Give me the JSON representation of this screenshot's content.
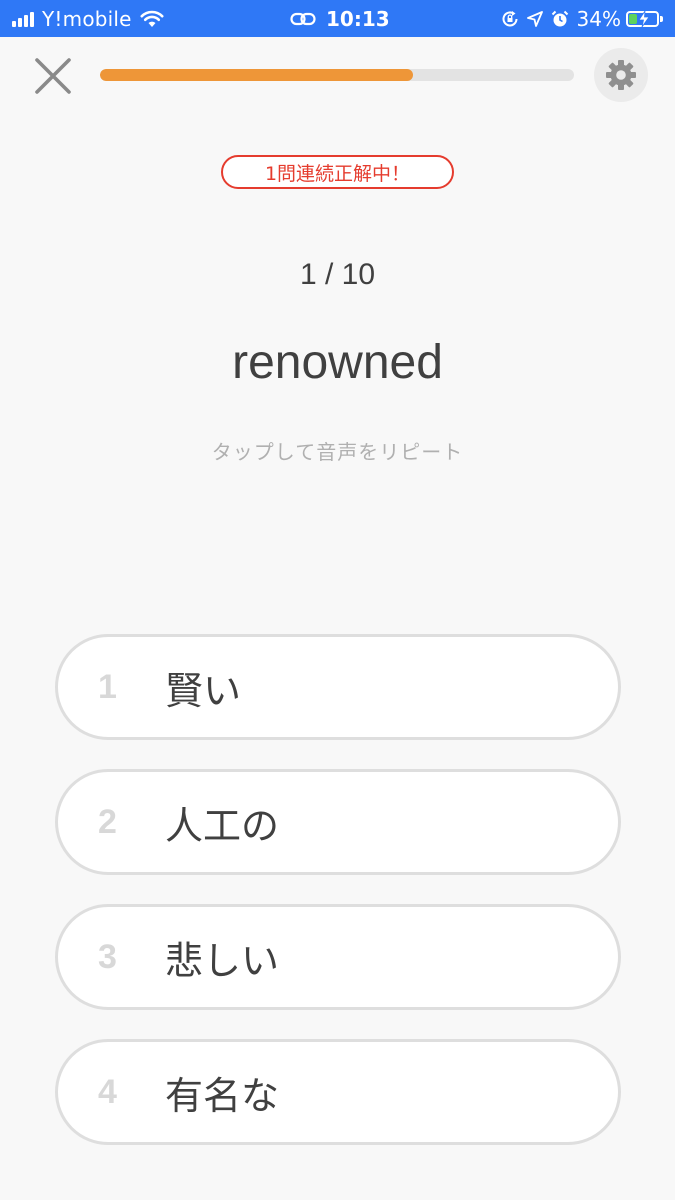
{
  "status_bar": {
    "carrier": "Y!mobile",
    "time": "10:13",
    "battery_percent": "34%",
    "battery_level": 0.34,
    "icons": [
      "signal-icon",
      "wifi-icon",
      "link-icon",
      "orientation-lock-icon",
      "location-icon",
      "alarm-icon",
      "battery-icon",
      "charging-icon"
    ]
  },
  "quiz": {
    "progress_fraction": 0.66,
    "streak_text": "1問連続正解中！",
    "counter": "1 / 10",
    "word": "renowned",
    "repeat_hint": "タップして音声をリピート"
  },
  "options": [
    {
      "number": "1",
      "text": "賢い"
    },
    {
      "number": "2",
      "text": "人工の"
    },
    {
      "number": "3",
      "text": "悲しい"
    },
    {
      "number": "4",
      "text": "有名な"
    }
  ],
  "colors": {
    "status_bar": "#2f78f6",
    "progress_fill": "#ee9638",
    "progress_track": "#e3e3e3",
    "streak_red": "#e53c2e",
    "background": "#f8f8f8"
  }
}
